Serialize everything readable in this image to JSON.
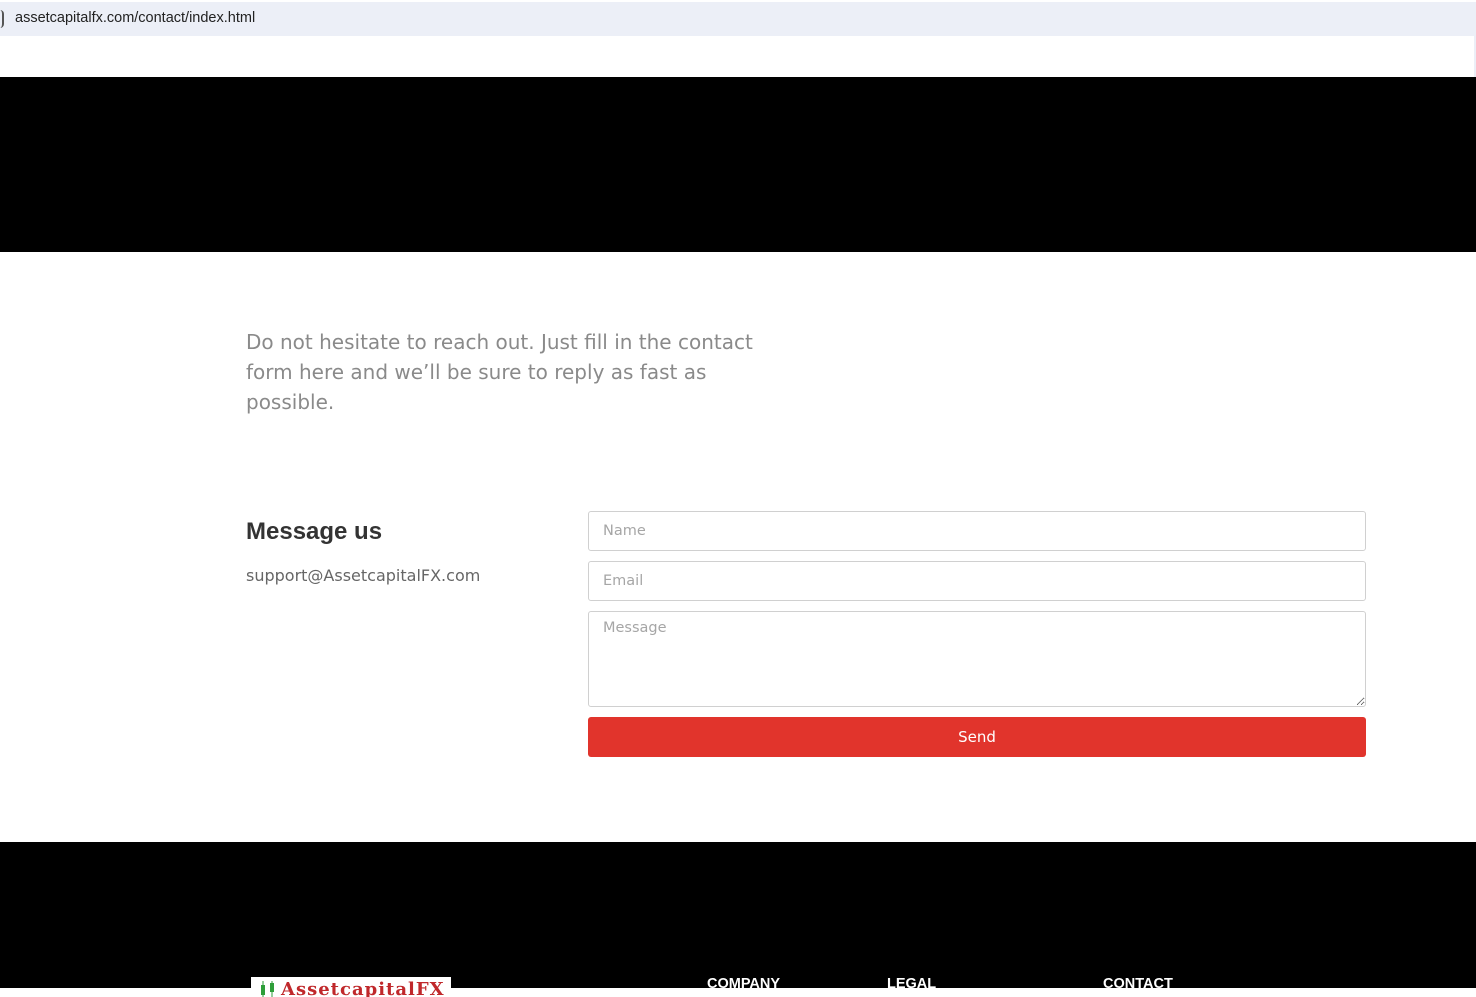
{
  "browser": {
    "url": "assetcapitalfx.com/contact/index.html"
  },
  "intro": {
    "text": "Do not hesitate to reach out. Just fill in the contact form here and we’ll be sure to reply as fast as possible."
  },
  "contact": {
    "title": "Message us",
    "email": "support@AssetcapitalFX.com"
  },
  "form": {
    "name_placeholder": "Name",
    "email_placeholder": "Email",
    "message_placeholder": "Message",
    "send_label": "Send",
    "accent_color": "#e1342c"
  },
  "footer": {
    "logo_text": "AssetcapitalFX",
    "headings": {
      "company": "COMPANY",
      "legal": "LEGAL",
      "contact": "CONTACT"
    }
  }
}
